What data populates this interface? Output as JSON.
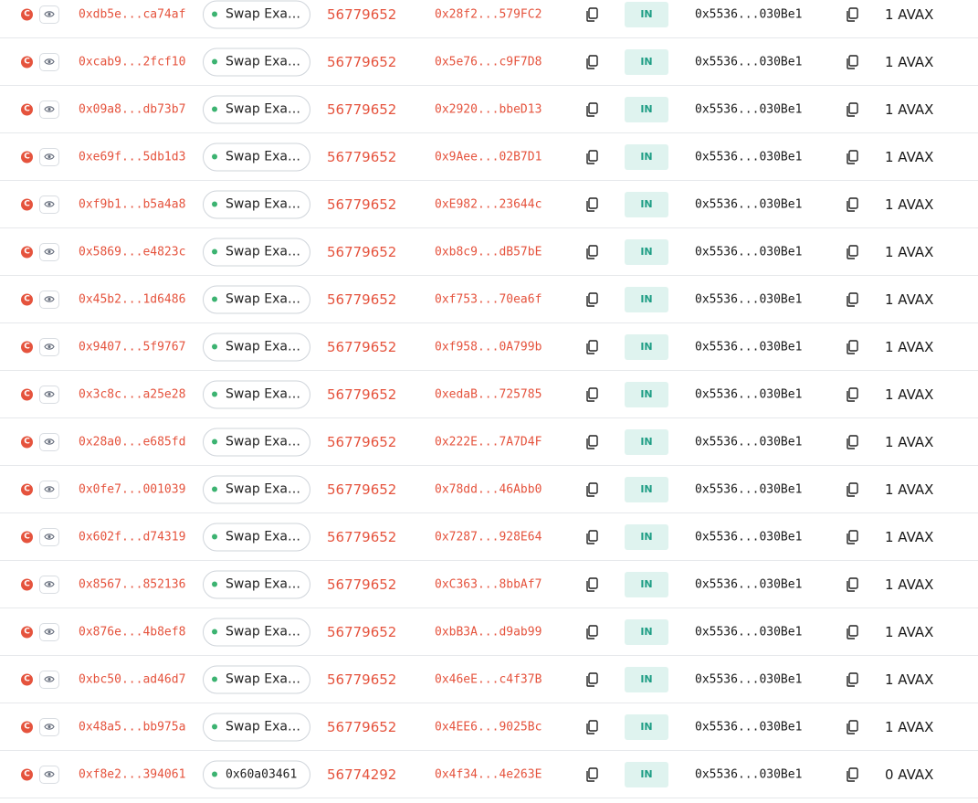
{
  "transactions": [
    {
      "hash": "0xdb5e...ca74af",
      "method": "Swap Exac...",
      "block": "56779652",
      "from": "0x28f2...579FC2",
      "direction": "IN",
      "to": "0x5536...030Be1",
      "value": "1 AVAX"
    },
    {
      "hash": "0xcab9...2fcf10",
      "method": "Swap Exac...",
      "block": "56779652",
      "from": "0x5e76...c9F7D8",
      "direction": "IN",
      "to": "0x5536...030Be1",
      "value": "1 AVAX"
    },
    {
      "hash": "0x09a8...db73b7",
      "method": "Swap Exac...",
      "block": "56779652",
      "from": "0x2920...bbeD13",
      "direction": "IN",
      "to": "0x5536...030Be1",
      "value": "1 AVAX"
    },
    {
      "hash": "0xe69f...5db1d3",
      "method": "Swap Exac...",
      "block": "56779652",
      "from": "0x9Aee...02B7D1",
      "direction": "IN",
      "to": "0x5536...030Be1",
      "value": "1 AVAX"
    },
    {
      "hash": "0xf9b1...b5a4a8",
      "method": "Swap Exac...",
      "block": "56779652",
      "from": "0xE982...23644c",
      "direction": "IN",
      "to": "0x5536...030Be1",
      "value": "1 AVAX"
    },
    {
      "hash": "0x5869...e4823c",
      "method": "Swap Exac...",
      "block": "56779652",
      "from": "0xb8c9...dB57bE",
      "direction": "IN",
      "to": "0x5536...030Be1",
      "value": "1 AVAX"
    },
    {
      "hash": "0x45b2...1d6486",
      "method": "Swap Exac...",
      "block": "56779652",
      "from": "0xf753...70ea6f",
      "direction": "IN",
      "to": "0x5536...030Be1",
      "value": "1 AVAX"
    },
    {
      "hash": "0x9407...5f9767",
      "method": "Swap Exac...",
      "block": "56779652",
      "from": "0xf958...0A799b",
      "direction": "IN",
      "to": "0x5536...030Be1",
      "value": "1 AVAX"
    },
    {
      "hash": "0x3c8c...a25e28",
      "method": "Swap Exac...",
      "block": "56779652",
      "from": "0xedaB...725785",
      "direction": "IN",
      "to": "0x5536...030Be1",
      "value": "1 AVAX"
    },
    {
      "hash": "0x28a0...e685fd",
      "method": "Swap Exac...",
      "block": "56779652",
      "from": "0x222E...7A7D4F",
      "direction": "IN",
      "to": "0x5536...030Be1",
      "value": "1 AVAX"
    },
    {
      "hash": "0x0fe7...001039",
      "method": "Swap Exac...",
      "block": "56779652",
      "from": "0x78dd...46Abb0",
      "direction": "IN",
      "to": "0x5536...030Be1",
      "value": "1 AVAX"
    },
    {
      "hash": "0x602f...d74319",
      "method": "Swap Exac...",
      "block": "56779652",
      "from": "0x7287...928E64",
      "direction": "IN",
      "to": "0x5536...030Be1",
      "value": "1 AVAX"
    },
    {
      "hash": "0x8567...852136",
      "method": "Swap Exac...",
      "block": "56779652",
      "from": "0xC363...8bbAf7",
      "direction": "IN",
      "to": "0x5536...030Be1",
      "value": "1 AVAX"
    },
    {
      "hash": "0x876e...4b8ef8",
      "method": "Swap Exac...",
      "block": "56779652",
      "from": "0xbB3A...d9ab99",
      "direction": "IN",
      "to": "0x5536...030Be1",
      "value": "1 AVAX"
    },
    {
      "hash": "0xbc50...ad46d7",
      "method": "Swap Exac...",
      "block": "56779652",
      "from": "0x46eE...c4f37B",
      "direction": "IN",
      "to": "0x5536...030Be1",
      "value": "1 AVAX"
    },
    {
      "hash": "0x48a5...bb975a",
      "method": "Swap Exac...",
      "block": "56779652",
      "from": "0x4EE6...9025Bc",
      "direction": "IN",
      "to": "0x5536...030Be1",
      "value": "1 AVAX"
    },
    {
      "hash": "0xf8e2...394061",
      "method": "0x60a03461",
      "block": "56774292",
      "from": "0x4f34...4e263E",
      "direction": "IN",
      "to": "0x5536...030Be1",
      "value": "0 AVAX"
    }
  ],
  "icons": {
    "contract": "contract-c-icon",
    "view": "eye-icon",
    "method_status": "green-dot-icon",
    "copy": "copy-icon"
  },
  "colors": {
    "accent_red": "#e5533d",
    "in_badge_bg": "#dff3ef",
    "in_badge_text": "#1f9e85",
    "method_dot": "#3cb371"
  },
  "labels": {
    "contract_badge": "C"
  }
}
